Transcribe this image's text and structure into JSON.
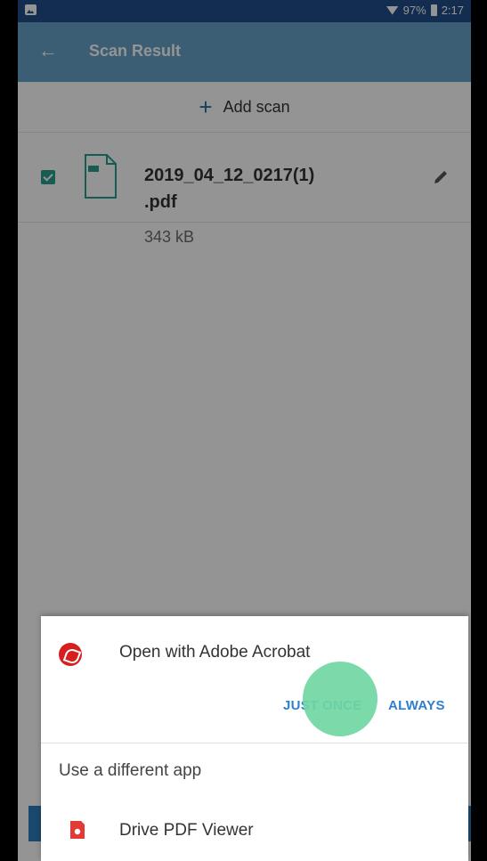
{
  "status_bar": {
    "battery": "97%",
    "time": "2:17"
  },
  "app_bar": {
    "title": "Scan Result"
  },
  "add_scan": {
    "label": "Add scan"
  },
  "file": {
    "name": "2019_04_12_0217(1)\n.pdf",
    "size": "343 kB",
    "checked": true
  },
  "sheet": {
    "title": "Open with Adobe Acrobat",
    "just_once": "JUST ONCE",
    "always": "ALWAYS",
    "use_different_app": "Use a different app",
    "alt_app": "Drive PDF Viewer"
  },
  "colors": {
    "status_bar": "#1f4f8a",
    "app_bar": "#66a2c8",
    "accent": "#2a9d8f",
    "button_text": "#2f7fd0",
    "touch": "#71d6a2"
  }
}
